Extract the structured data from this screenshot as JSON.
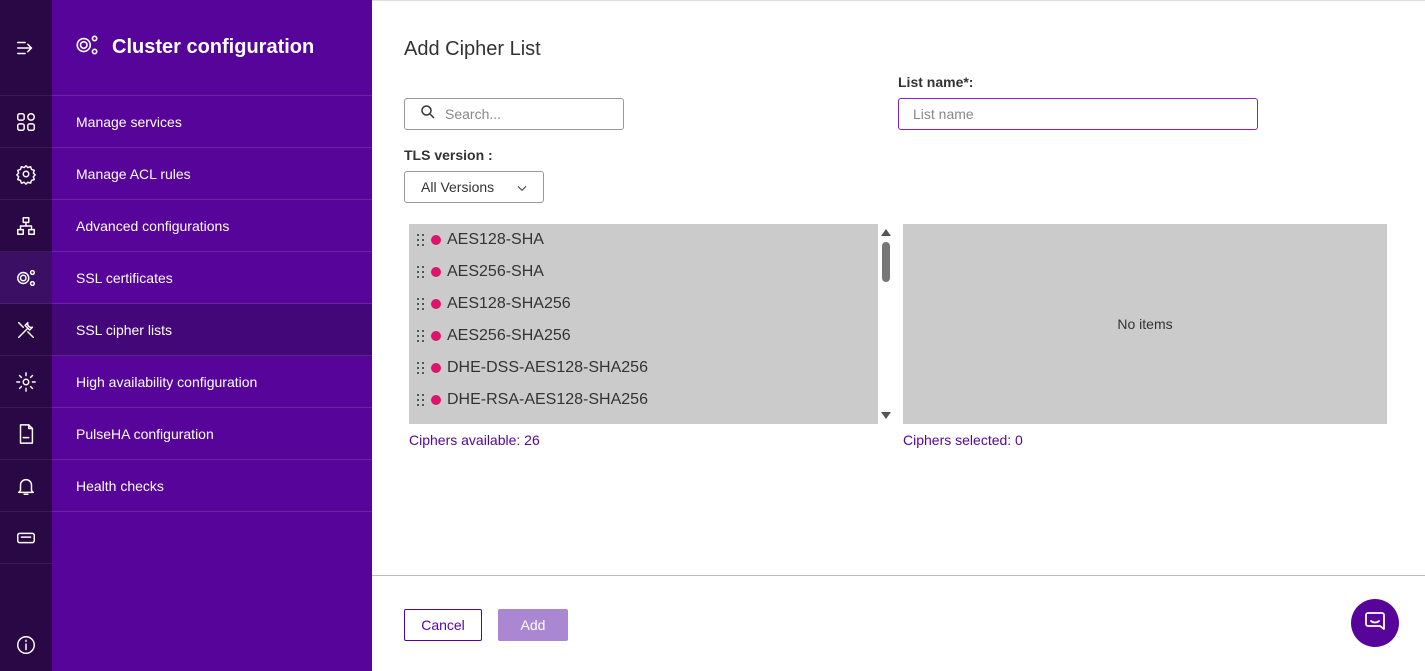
{
  "sidebar": {
    "title": "Cluster configuration",
    "items": [
      {
        "label": "Manage services"
      },
      {
        "label": "Manage ACL rules"
      },
      {
        "label": "Advanced configurations"
      },
      {
        "label": "SSL certificates"
      },
      {
        "label": "SSL cipher lists",
        "active": true
      },
      {
        "label": "High availability configuration"
      },
      {
        "label": "PulseHA configuration"
      },
      {
        "label": "Health checks"
      }
    ]
  },
  "rail": {
    "icons": [
      "menu-expand-icon",
      "grid-apps-icon",
      "location-gear-icon",
      "network-icon",
      "gears-icon",
      "tools-icon",
      "gear-icon",
      "log-file-icon",
      "bell-icon",
      "ticket-icon",
      "info-icon"
    ]
  },
  "dialog": {
    "title": "Add Cipher List",
    "search": {
      "placeholder": "Search..."
    },
    "list_name": {
      "label": "List name*:",
      "placeholder": "List name"
    },
    "tls": {
      "label": "TLS version :",
      "value": "All Versions"
    },
    "available": {
      "ciphers": [
        "AES128-SHA",
        "AES256-SHA",
        "AES128-SHA256",
        "AES256-SHA256",
        "DHE-DSS-AES128-SHA256",
        "DHE-RSA-AES128-SHA256"
      ],
      "count_label": "Ciphers available: 26"
    },
    "selected": {
      "empty_text": "No items",
      "count_label": "Ciphers selected: 0"
    },
    "buttons": {
      "cancel": "Cancel",
      "add": "Add"
    }
  },
  "colors": {
    "rail_bg": "#2a0845",
    "sidebar_bg": "#56049a",
    "accent": "#56049a",
    "cipher_dot": "#e0126a",
    "add_button_disabled": "#ab87d3"
  }
}
